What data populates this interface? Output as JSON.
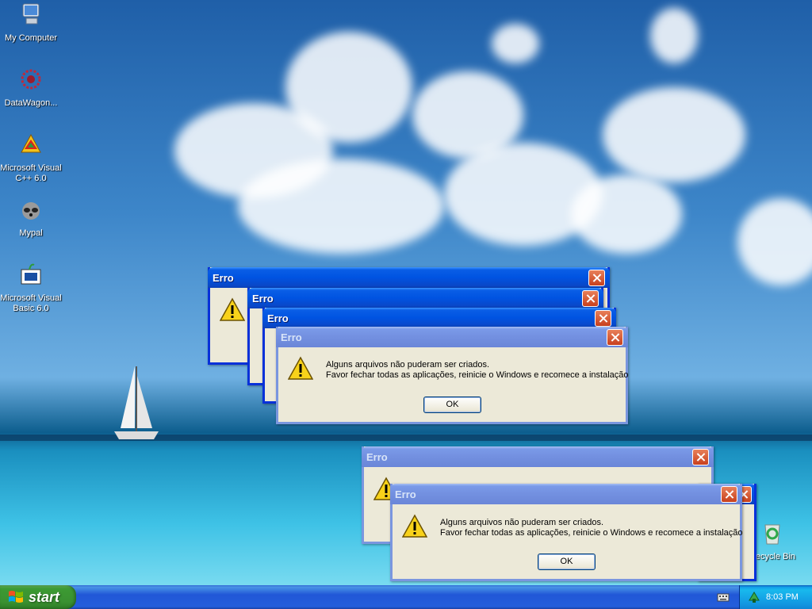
{
  "desktop": {
    "icons": [
      {
        "label": "My Computer"
      },
      {
        "label": "DataWagon..."
      },
      {
        "label": "Microsoft Visual C++ 6.0"
      },
      {
        "label": "Mypal"
      },
      {
        "label": "Microsoft Visual Basic 6.0"
      },
      {
        "label": "Recycle Bin"
      }
    ]
  },
  "dialogs": [
    {
      "title": "Erro"
    },
    {
      "title": "Erro"
    },
    {
      "title": "Erro"
    },
    {
      "title": "Erro",
      "message_line1": "Alguns arquivos não puderam ser criados.",
      "message_line2": "Favor fechar todas as aplicações, reinicie o Windows e recomece a instalação",
      "ok_label": "OK"
    },
    {
      "title": "Erro"
    },
    {
      "title": "Erro",
      "message_line1": "Alguns arquivos não puderam ser criados.",
      "message_line2": "Favor fechar todas as aplicações, reinicie o Windows e recomece a instalação",
      "ok_label": "OK"
    }
  ],
  "taskbar": {
    "start_label": "start",
    "clock": "8:03 PM"
  }
}
